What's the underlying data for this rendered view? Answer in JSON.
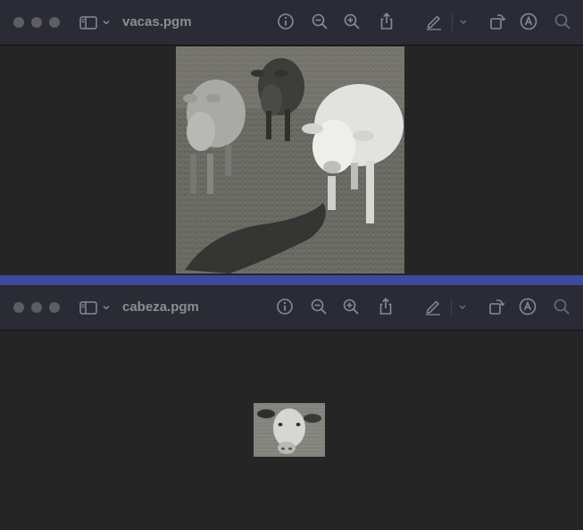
{
  "windows": [
    {
      "title": "vacas.pgm",
      "toolbar": [
        "info-icon",
        "zoom-out-icon",
        "zoom-in-icon",
        "share-icon",
        "markup-pen-icon",
        "chevron-down-icon",
        "rotate-icon",
        "annotate-icon",
        "search-icon"
      ],
      "image_name": "cows-in-pasture-photo"
    },
    {
      "title": "cabeza.pgm",
      "toolbar": [
        "info-icon",
        "zoom-out-icon",
        "zoom-in-icon",
        "share-icon",
        "markup-pen-icon",
        "chevron-down-icon",
        "rotate-icon",
        "annotate-icon",
        "search-icon"
      ],
      "image_name": "cow-head-crop-photo"
    }
  ],
  "colors": {
    "titlebar": "#2b2b36",
    "canvas": "#252525",
    "window_gap": "#3b4a9e",
    "icon": "#8a8a96"
  }
}
